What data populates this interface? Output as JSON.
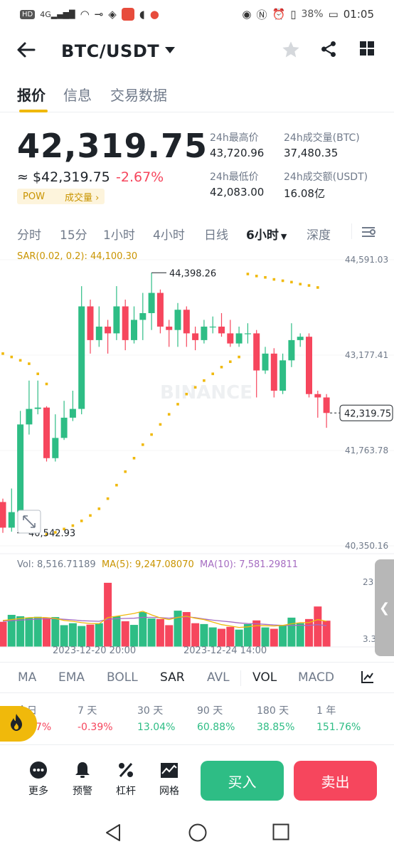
{
  "status_bar": {
    "left_chips": [
      "HD",
      "4G"
    ],
    "battery": "38%",
    "time": "01:05"
  },
  "header": {
    "pair": "BTC/USDT"
  },
  "tabs": [
    {
      "label": "报价",
      "active": true
    },
    {
      "label": "信息",
      "active": false
    },
    {
      "label": "交易数据",
      "active": false
    }
  ],
  "price": {
    "last": "42,319.75",
    "usd": "≈ $42,319.75",
    "change": "-2.67%",
    "tag_pow": "POW",
    "tag_volume": "成交量",
    "tag_arrow": "›"
  },
  "stats": {
    "high_label": "24h最高价",
    "high_value": "43,720.96",
    "vol_btc_label": "24h成交量(BTC)",
    "vol_btc_value": "37,480.35",
    "low_label": "24h最低价",
    "low_value": "42,083.00",
    "vol_usdt_label": "24h成交额(USDT)",
    "vol_usdt_value": "16.08亿"
  },
  "timeframes": [
    {
      "label": "分时",
      "active": false
    },
    {
      "label": "15分",
      "active": false
    },
    {
      "label": "1小时",
      "active": false
    },
    {
      "label": "4小时",
      "active": false
    },
    {
      "label": "日线",
      "active": false
    },
    {
      "label": "6小时",
      "active": true
    },
    {
      "label": "深度",
      "active": false
    }
  ],
  "chart_data": {
    "type": "candlestick",
    "indicator_label": "SAR(0.02, 0.2): 44,100.30",
    "y_ticks": [
      "44,591.03",
      "43,177.41",
      "41,763.78",
      "40,350.16"
    ],
    "ylim": [
      40350.16,
      44591.03
    ],
    "last_price_label": "42,319.75",
    "last_price": 42319.75,
    "high_marker": "44,398.26",
    "high_marker_value": 44398.26,
    "low_marker": "40,542.93",
    "low_marker_value": 40542.93,
    "watermark": "BINANCE",
    "candles": [
      {
        "o": 41000,
        "c": 40620,
        "h": 41050,
        "l": 40542.93
      },
      {
        "o": 40620,
        "c": 40850,
        "h": 41200,
        "l": 40560
      },
      {
        "o": 40850,
        "c": 42150,
        "h": 42350,
        "l": 40800
      },
      {
        "o": 42150,
        "c": 42380,
        "h": 42800,
        "l": 42000
      },
      {
        "o": 42380,
        "c": 42400,
        "h": 42800,
        "l": 42300
      },
      {
        "o": 42400,
        "c": 41650,
        "h": 42420,
        "l": 41600
      },
      {
        "o": 41650,
        "c": 41950,
        "h": 42300,
        "l": 41600
      },
      {
        "o": 41950,
        "c": 42250,
        "h": 42500,
        "l": 41920
      },
      {
        "o": 42250,
        "c": 42380,
        "h": 42650,
        "l": 42200
      },
      {
        "o": 42380,
        "c": 43900,
        "h": 44200,
        "l": 42300
      },
      {
        "o": 43900,
        "c": 43400,
        "h": 44000,
        "l": 43200
      },
      {
        "o": 43400,
        "c": 43600,
        "h": 43900,
        "l": 43300
      },
      {
        "o": 43600,
        "c": 43500,
        "h": 43700,
        "l": 43200
      },
      {
        "o": 43500,
        "c": 43900,
        "h": 44200,
        "l": 43400
      },
      {
        "o": 43900,
        "c": 43400,
        "h": 44000,
        "l": 43250
      },
      {
        "o": 43400,
        "c": 43700,
        "h": 43900,
        "l": 43350
      },
      {
        "o": 43700,
        "c": 43800,
        "h": 44100,
        "l": 43400
      },
      {
        "o": 43800,
        "c": 44100,
        "h": 44398.26,
        "l": 43550
      },
      {
        "o": 44100,
        "c": 43600,
        "h": 44150,
        "l": 43500
      },
      {
        "o": 43600,
        "c": 43550,
        "h": 43700,
        "l": 43300
      },
      {
        "o": 43550,
        "c": 43850,
        "h": 43950,
        "l": 43300
      },
      {
        "o": 43850,
        "c": 43500,
        "h": 43900,
        "l": 43300
      },
      {
        "o": 43500,
        "c": 43400,
        "h": 43600,
        "l": 43250
      },
      {
        "o": 43400,
        "c": 43600,
        "h": 43700,
        "l": 43350
      },
      {
        "o": 43600,
        "c": 43600,
        "h": 43750,
        "l": 43500
      },
      {
        "o": 43600,
        "c": 43500,
        "h": 43800,
        "l": 43450
      },
      {
        "o": 43500,
        "c": 43350,
        "h": 43700,
        "l": 43300
      },
      {
        "o": 43350,
        "c": 43500,
        "h": 43600,
        "l": 43300
      },
      {
        "o": 43500,
        "c": 43500,
        "h": 43650,
        "l": 43350
      },
      {
        "o": 43500,
        "c": 42950,
        "h": 43550,
        "l": 42550
      },
      {
        "o": 42950,
        "c": 43200,
        "h": 43300,
        "l": 42900
      },
      {
        "o": 43200,
        "c": 42650,
        "h": 43280,
        "l": 42550
      },
      {
        "o": 42650,
        "c": 43100,
        "h": 43200,
        "l": 42600
      },
      {
        "o": 43100,
        "c": 43400,
        "h": 43650,
        "l": 43000
      },
      {
        "o": 43400,
        "c": 43450,
        "h": 43500,
        "l": 43300
      },
      {
        "o": 43450,
        "c": 42600,
        "h": 43500,
        "l": 42550
      },
      {
        "o": 42600,
        "c": 42550,
        "h": 42650,
        "l": 42250
      },
      {
        "o": 42550,
        "c": 42319.75,
        "h": 42600,
        "l": 42100
      }
    ],
    "sar_dots": [
      {
        "i": 0,
        "v": 43200
      },
      {
        "i": 1,
        "v": 43150
      },
      {
        "i": 2,
        "v": 43100
      },
      {
        "i": 3,
        "v": 43050
      },
      {
        "i": 4,
        "v": 42900
      },
      {
        "i": 5,
        "v": 42750
      },
      {
        "i": 5,
        "v": 40520
      },
      {
        "i": 6,
        "v": 40550
      },
      {
        "i": 7,
        "v": 40600
      },
      {
        "i": 8,
        "v": 40650
      },
      {
        "i": 9,
        "v": 40720
      },
      {
        "i": 10,
        "v": 40800
      },
      {
        "i": 11,
        "v": 40900
      },
      {
        "i": 12,
        "v": 41050
      },
      {
        "i": 13,
        "v": 41250
      },
      {
        "i": 14,
        "v": 41450
      },
      {
        "i": 15,
        "v": 41650
      },
      {
        "i": 16,
        "v": 41850
      },
      {
        "i": 17,
        "v": 42000
      },
      {
        "i": 18,
        "v": 42150
      },
      {
        "i": 19,
        "v": 42300
      },
      {
        "i": 20,
        "v": 42450
      },
      {
        "i": 21,
        "v": 42600
      },
      {
        "i": 22,
        "v": 42700
      },
      {
        "i": 23,
        "v": 42800
      },
      {
        "i": 24,
        "v": 42900
      },
      {
        "i": 25,
        "v": 43000
      },
      {
        "i": 26,
        "v": 43080
      },
      {
        "i": 27,
        "v": 43150
      },
      {
        "i": 28,
        "v": 44380
      },
      {
        "i": 29,
        "v": 44350
      },
      {
        "i": 30,
        "v": 44330
      },
      {
        "i": 31,
        "v": 44300
      },
      {
        "i": 32,
        "v": 44280
      },
      {
        "i": 33,
        "v": 44260
      },
      {
        "i": 34,
        "v": 44230
      },
      {
        "i": 35,
        "v": 44210
      },
      {
        "i": 36,
        "v": 44180
      }
    ],
    "volume": {
      "label_vol": "Vol: 8,516.71189",
      "label_ma5": "MA(5): 9,247.08070",
      "label_ma10": "MA(10): 7,581.29811",
      "y_tick_top": "23",
      "y_tick_bottom": "3.3",
      "ylim": [
        0,
        24000
      ],
      "values": [
        9000,
        11500,
        11000,
        10500,
        10800,
        10500,
        10700,
        7800,
        8500,
        7500,
        8000,
        8500,
        23000,
        11000,
        9200,
        7900,
        12500,
        10200,
        10000,
        7800,
        13000,
        12500,
        8500,
        8200,
        7000,
        6500,
        7200,
        6200,
        8200,
        9500,
        7000,
        6500,
        7800,
        10500,
        8500,
        10000,
        14500,
        9400
      ],
      "ma5": [
        9500,
        9800,
        10200,
        10500,
        10600,
        10500,
        10200,
        9500,
        9200,
        8700,
        8400,
        8300,
        10500,
        11000,
        11500,
        12000,
        12800,
        11500,
        10400,
        9800,
        10600,
        11000,
        10300,
        9800,
        8900,
        8000,
        7500,
        7000,
        7200,
        7600,
        7600,
        7500,
        7700,
        8300,
        8700,
        8700,
        9800,
        9200
      ],
      "ma10": [
        9200,
        9400,
        9600,
        9800,
        10000,
        10100,
        10100,
        9900,
        9700,
        9400,
        9300,
        9200,
        9900,
        10100,
        10200,
        10300,
        10600,
        10600,
        10500,
        10300,
        10600,
        10800,
        10500,
        10000,
        9600,
        9300,
        9000,
        8600,
        8400,
        8300,
        8100,
        7900,
        7700,
        7700,
        7800,
        7700,
        8000,
        7600
      ]
    },
    "x_labels": [
      "2023-12-20 20:00",
      "2023-12-24 14:00"
    ]
  },
  "indicators": [
    {
      "label": "MA",
      "active": false
    },
    {
      "label": "EMA",
      "active": false
    },
    {
      "label": "BOLL",
      "active": false
    },
    {
      "label": "SAR",
      "active": true
    },
    {
      "label": "AVL",
      "active": false
    },
    {
      "label": "VOL",
      "active": true
    },
    {
      "label": "MACD",
      "active": false
    }
  ],
  "performance": [
    {
      "label": "今日",
      "value": "7%",
      "color": "#f6465d"
    },
    {
      "label": "7 天",
      "value": "-0.39%",
      "color": "#f6465d"
    },
    {
      "label": "30 天",
      "value": "13.04%",
      "color": "#2ebd85"
    },
    {
      "label": "90 天",
      "value": "60.88%",
      "color": "#2ebd85"
    },
    {
      "label": "180 天",
      "value": "38.85%",
      "color": "#2ebd85"
    },
    {
      "label": "1 年",
      "value": "151.76%",
      "color": "#2ebd85"
    }
  ],
  "bottom_bar": {
    "more": "更多",
    "alert": "预警",
    "leverage": "杠杆",
    "grid": "网格",
    "buy": "买入",
    "sell": "卖出"
  },
  "colors": {
    "up": "#2ebd85",
    "down": "#f6465d",
    "accent": "#f0b90b",
    "ma5": "#f0b90b",
    "ma10": "#a56cc1"
  }
}
